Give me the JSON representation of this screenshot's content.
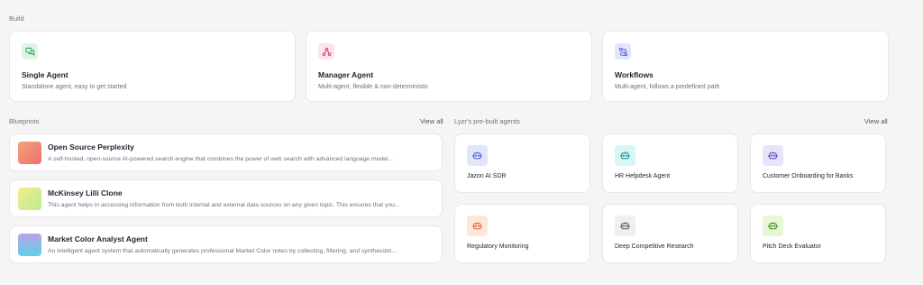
{
  "build": {
    "label": "Build",
    "cards": [
      {
        "title": "Single Agent",
        "desc": "Standalone agent, easy to get started",
        "icon": "chat-icon",
        "icon_bg": "#dcf5e4",
        "icon_color": "#2f9e5b"
      },
      {
        "title": "Manager Agent",
        "desc": "Multi-agent, flexible & non-deterministic",
        "icon": "network-icon",
        "icon_bg": "#fde4ec",
        "icon_color": "#d6336c"
      },
      {
        "title": "Workflows",
        "desc": "Multi-agent, follows a predefined path",
        "icon": "route-icon",
        "icon_bg": "#e3e6fb",
        "icon_color": "#4f5bd5"
      }
    ]
  },
  "blueprints": {
    "label": "Blueprints",
    "view_all": "View all",
    "items": [
      {
        "title": "Open Source Perplexity",
        "desc": "A self-hosted, open-source AI-powered search engine that combines the power of web search with advanced language model..."
      },
      {
        "title": "McKinsey Lilli Clone",
        "desc": "This agent helps in accessing information from both internal and external data sources on any given topic. This ensures that you..."
      },
      {
        "title": "Market Color Analyst Agent",
        "desc": "An intelligent agent system that automatically generates professional Market Color notes by collecting, filtering, and synthesizin..."
      }
    ]
  },
  "prebuilt": {
    "label": "Lyzr's pre-built agents",
    "view_all": "View all",
    "agents": [
      {
        "title": "Jazon AI SDR",
        "icon": "robot-icon",
        "icon_bg": "#e1e6fb",
        "icon_color": "#4f5bd5"
      },
      {
        "title": "HR Helpdesk Agent",
        "icon": "robot-icon",
        "icon_bg": "#d6f6f7",
        "icon_color": "#1b8f96"
      },
      {
        "title": "Customer Onboarding for Banks",
        "icon": "robot-icon",
        "icon_bg": "#e7e3fa",
        "icon_color": "#5b49c4"
      },
      {
        "title": "Regulatory Monitoring",
        "icon": "robot-icon",
        "icon_bg": "#fde8d8",
        "icon_color": "#d9622b"
      },
      {
        "title": "Deep Competitive Research",
        "icon": "robot-icon",
        "icon_bg": "#eeeff1",
        "icon_color": "#4b5563"
      },
      {
        "title": "Pitch Deck Evaluator",
        "icon": "robot-icon",
        "icon_bg": "#e6f6d6",
        "icon_color": "#3f8a1e"
      }
    ]
  }
}
